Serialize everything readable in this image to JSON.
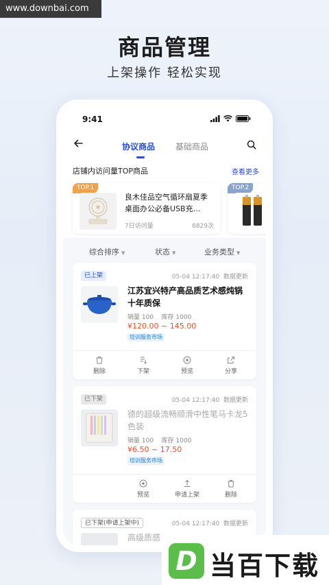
{
  "watermark": "www.downbai.com",
  "hero": {
    "title": "商品管理",
    "subtitle": "上架操作  轻松实现"
  },
  "status_bar": {
    "time": "9:41"
  },
  "nav": {
    "tabs": [
      {
        "label": "协议商品",
        "active": true
      },
      {
        "label": "基础商品",
        "active": false
      }
    ]
  },
  "top_section": {
    "title": "店铺内访问量TOP商品",
    "more": "查看更多",
    "items": [
      {
        "rank": "TOP.1",
        "name": "良木佳品空气循环扇夏季桌面办公必备USB充…",
        "meta_label": "7日访问量",
        "count": "6829次",
        "rank_color": "#f0a24a"
      },
      {
        "rank": "TOP.2",
        "name": "",
        "meta_label": "",
        "count": "",
        "rank_color": "#8aa3c8"
      }
    ]
  },
  "filters": [
    {
      "label": "综合排序"
    },
    {
      "label": "状态"
    },
    {
      "label": "业务类型"
    }
  ],
  "products": [
    {
      "status": "已上架",
      "date": "05-04  12:17:40",
      "update": "数据更新",
      "title": "江苏宜兴特产高品质艺术感炖锅十年质保",
      "sales_label": "销量",
      "sales": "100",
      "stock_label": "库存",
      "stock": "1000",
      "price": "¥120.00 ~ 145.00",
      "tag": "培训服务市场",
      "actions": [
        "删除",
        "下架",
        "预览",
        "分享"
      ]
    },
    {
      "status": "已下架",
      "date": "05-04  12:17:40",
      "update": "数据更新",
      "title": "德的超级流畅顺滑中性笔马卡龙5色装",
      "sales_label": "销量",
      "sales": "100",
      "stock_label": "库存",
      "stock": "1000",
      "price": "¥6.50 ~ 17.50",
      "tag": "培训服务市场",
      "actions": [
        "预览",
        "申请上架",
        "删除"
      ]
    },
    {
      "status": "已下架(申请上架中)",
      "date": "05-04  12:17:40",
      "update": "数据更新",
      "title": "高级质感"
    }
  ],
  "brand": {
    "logo_letter": "D",
    "name": "当百下载"
  },
  "colors": {
    "accent": "#2a4fc8",
    "price": "#e0522b",
    "brand_green": "#5bbd4a"
  }
}
